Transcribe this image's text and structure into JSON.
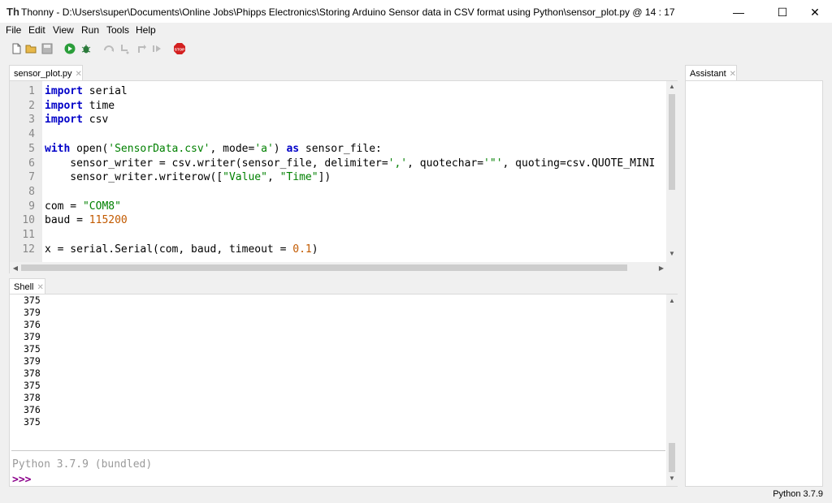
{
  "window": {
    "app_icon": "Th",
    "title": "Thonny  -  D:\\Users\\super\\Documents\\Online Jobs\\Phipps Electronics\\Storing Arduino Sensor data in CSV format using Python\\sensor_plot.py  @  14 : 17",
    "minimize": "—",
    "maximize": "☐",
    "close": "✕"
  },
  "menu": [
    "File",
    "Edit",
    "View",
    "Run",
    "Tools",
    "Help"
  ],
  "toolbar": {
    "icons": [
      "new-file-icon",
      "open-folder-icon",
      "save-icon",
      "run-icon",
      "debug-icon",
      "step-over-icon",
      "step-into-icon",
      "step-out-icon",
      "resume-icon",
      "stop-icon"
    ],
    "stop_label": "STOP"
  },
  "editor": {
    "tab_label": "sensor_plot.py",
    "tab_close": "✕",
    "line_numbers": [
      "1",
      "2",
      "3",
      "4",
      "5",
      "6",
      "7",
      "8",
      "9",
      "10",
      "11",
      "12"
    ]
  },
  "shell": {
    "tab_label": "Shell",
    "tab_close": "✕",
    "output": [
      "375",
      "379",
      "376",
      "379",
      "375",
      "379",
      "378",
      "375",
      "378",
      "376",
      "375"
    ],
    "version_text": "Python 3.7.9 (bundled)",
    "prompt": ">>>"
  },
  "assistant": {
    "tab_label": "Assistant",
    "tab_close": "✕"
  },
  "statusbar": {
    "interpreter": "Python 3.7.9"
  },
  "colors": {
    "keyword": "#0000c8",
    "string": "#008000",
    "number": "#c25a00",
    "prompt": "#8b008b"
  }
}
